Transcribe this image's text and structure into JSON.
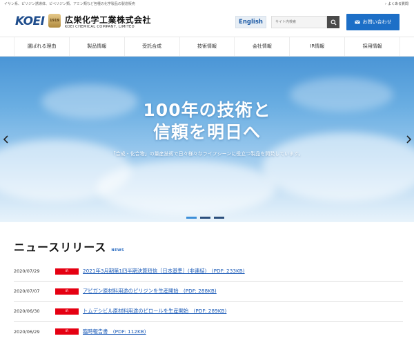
{
  "topbar": {
    "tagline": "イサン系、ピリジン誘導体、ピペリジン類、アミン類など各種の化学製品の製造販売",
    "faq_label": "よくある質問"
  },
  "header": {
    "logo_text": "KOEI",
    "emblem_text": "1919",
    "company_name_jp": "広栄化学工業株式会社",
    "company_name_en": "KOEI CHEMICAL COMPANY, LIMITED",
    "language_button": "English",
    "search_placeholder": "サイト内検索",
    "contact_button": "お問い合わせ"
  },
  "nav": {
    "items": [
      "選ばれる理由",
      "製品情報",
      "受託合成",
      "技術情報",
      "会社情報",
      "IR情報",
      "採用情報"
    ]
  },
  "hero": {
    "title_line1": "100年の技術と",
    "title_line2": "信頼を明日へ",
    "subtitle": "「合成・化合物」の量産技術で日々様々なライフシーンに役立つ製品を開発しています。",
    "active_slide": 1,
    "slide_count": 3
  },
  "news": {
    "title": "ニュースリリース",
    "subtitle": "NEWS",
    "items": [
      {
        "date": "2020/07/29",
        "badge": "IR",
        "text": "2021年3月期第1四半期決算短信〔日本基準〕(非連結)　(PDF: 233KB)"
      },
      {
        "date": "2020/07/07",
        "badge": "IR",
        "text": "アピガン原材料用途のピリジンを生産開始　(PDF: 288KB)"
      },
      {
        "date": "2020/06/30",
        "badge": "IR",
        "text": "トムデシビル原材料用途のピロールを生産開始　(PDF: 289KB)"
      },
      {
        "date": "2020/06/29",
        "badge": "IR",
        "text": "臨時報告書　(PDF: 112KB)"
      }
    ]
  },
  "colors": {
    "brand_blue": "#1f4d8c",
    "accent_blue": "#1d6fc7",
    "ir_badge_red": "#e50012"
  }
}
